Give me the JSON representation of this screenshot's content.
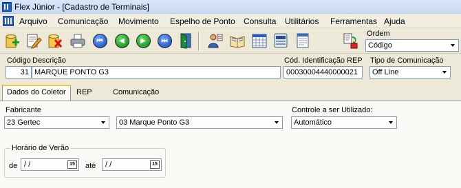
{
  "window": {
    "title": "Flex Júnior - [Cadastro de Terminais]"
  },
  "menu": [
    "Arquivo",
    "Comunicação",
    "Movimento",
    "Espelho de Ponto",
    "Consulta",
    "Utilitários",
    "Ferramentas",
    "Ajuda"
  ],
  "toolbar": {
    "icons": [
      "add-icon",
      "edit-icon",
      "delete-icon",
      "print-icon",
      "first-record-icon",
      "previous-record-icon",
      "next-record-icon",
      "last-record-icon",
      "exit-door-icon",
      "user-access-icon",
      "book-icon",
      "calendar-grid-icon",
      "terminal-icon",
      "document-icon",
      "sync-icon"
    ],
    "nav_glyphs": {
      "first": "⏮",
      "previous": "◀",
      "next": "▶",
      "last": "⏭"
    }
  },
  "ordem": {
    "label": "Ordem",
    "value": "Código"
  },
  "form": {
    "codigo_label": "Código",
    "codigo_value": "31",
    "descricao_label": "Descrição",
    "descricao_value": "MARQUE PONTO G3",
    "cod_rep_label": "Cód. Identificação REP",
    "cod_rep_value": "00030004440000021",
    "tipo_com_label": "Tipo de Comunicação",
    "tipo_com_value": "Off Line"
  },
  "tabs": [
    "Dados do Coletor",
    "REP",
    "Comunicação"
  ],
  "active_tab": 0,
  "coletor": {
    "fabricante_label": "Fabricante",
    "fabricante_value": "23 Gertec",
    "modelo_value": "03 Marque Ponto G3",
    "controle_label": "Controle a ser Utilizado:",
    "controle_value": "Automático"
  },
  "horario_verao": {
    "title": "Horário de Verão",
    "de_label": "de",
    "de_value": "/ /",
    "ate_label": "até",
    "ate_value": "/ /",
    "calendar_glyph": "15"
  }
}
